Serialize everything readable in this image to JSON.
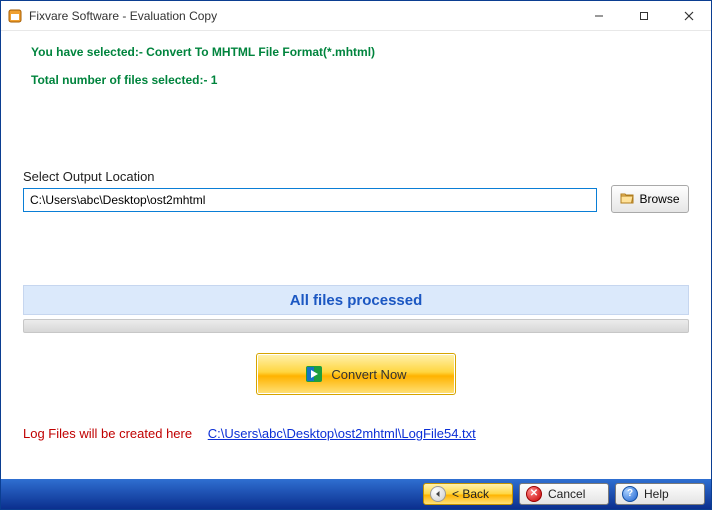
{
  "window": {
    "title": "Fixvare Software - Evaluation Copy"
  },
  "info": {
    "selected_format": "You have selected:- Convert To MHTML File Format(*.mhtml)",
    "file_count": "Total number of files selected:- 1"
  },
  "output": {
    "label": "Select Output Location",
    "path": "C:\\Users\\abc\\Desktop\\ost2mhtml",
    "browse_label": "Browse"
  },
  "status": {
    "message": "All files processed"
  },
  "convert": {
    "label": "Convert Now"
  },
  "log": {
    "prefix": "Log Files will be created here",
    "path": "C:\\Users\\abc\\Desktop\\ost2mhtml\\LogFile54.txt"
  },
  "footer": {
    "back": "< Back",
    "cancel": "Cancel",
    "help": "Help"
  }
}
